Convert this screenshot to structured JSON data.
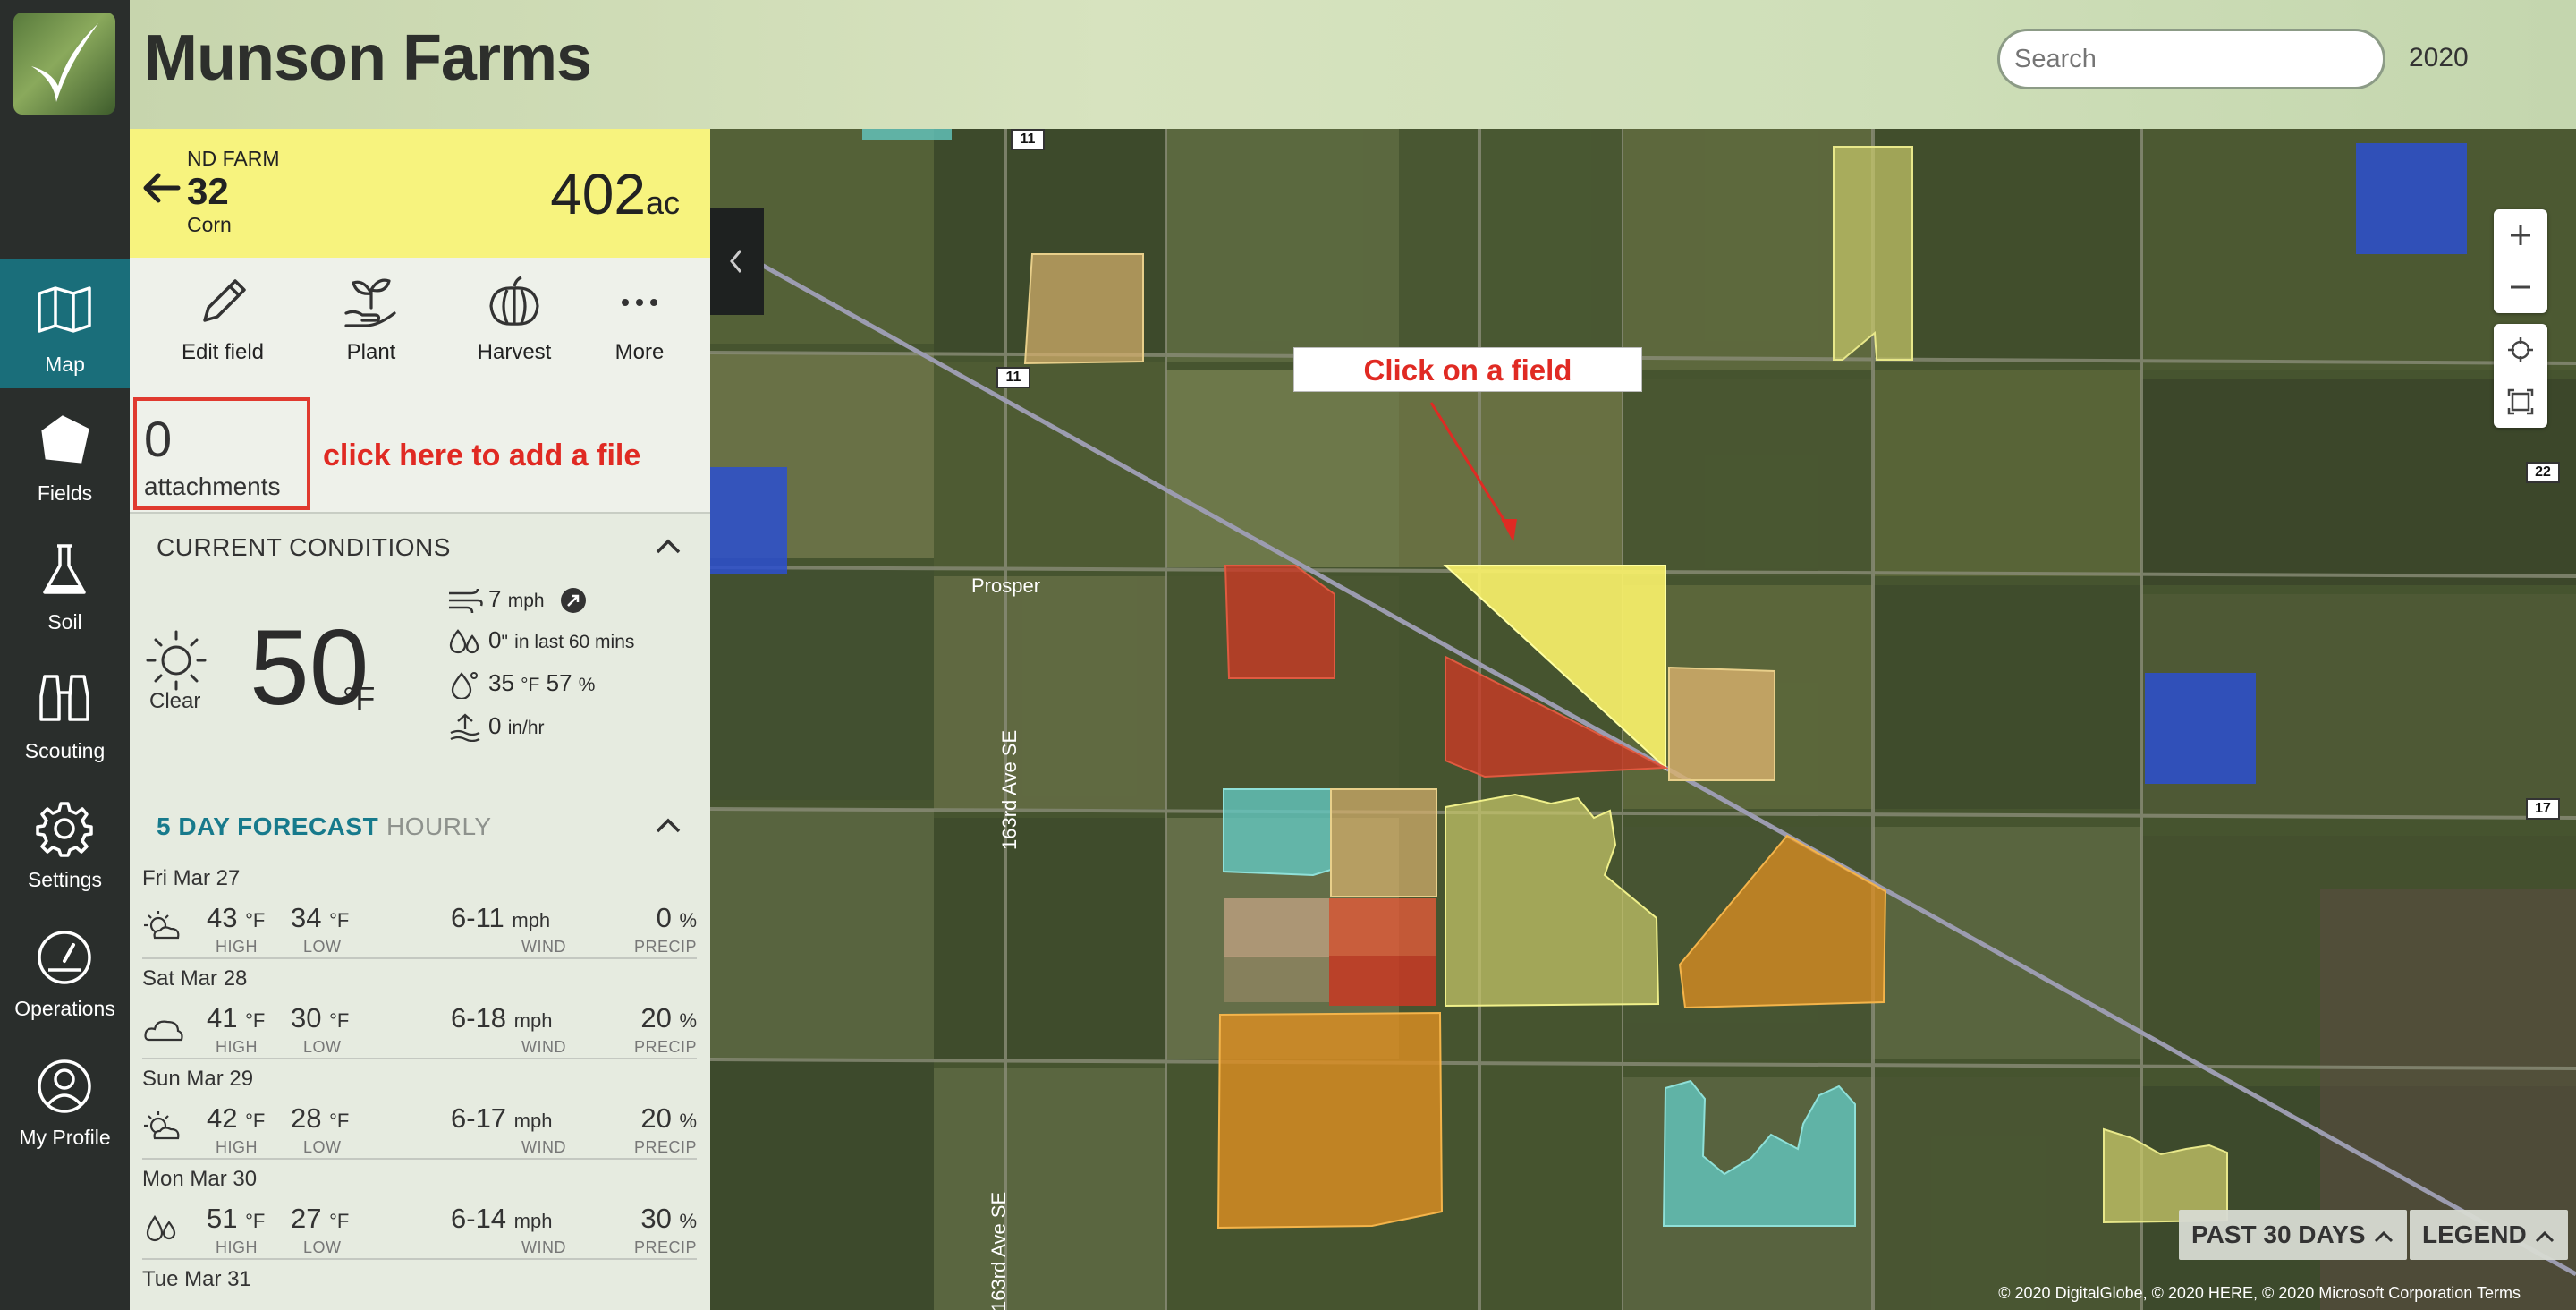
{
  "app": {
    "farm_name": "Munson Farms",
    "search_placeholder": "Search",
    "year": "2020"
  },
  "nav": {
    "items": [
      {
        "label": "Map",
        "icon": "map-icon",
        "active": true
      },
      {
        "label": "Fields",
        "icon": "fields-icon"
      },
      {
        "label": "Soil",
        "icon": "soil-flask-icon"
      },
      {
        "label": "Scouting",
        "icon": "binoculars-icon"
      },
      {
        "label": "Settings",
        "icon": "gear-icon"
      },
      {
        "label": "Operations",
        "icon": "gauge-icon"
      },
      {
        "label": "My Profile",
        "icon": "user-icon"
      }
    ]
  },
  "field": {
    "farm": "ND FARM",
    "number": "32",
    "crop": "Corn",
    "acres": "402",
    "acres_unit": "ac"
  },
  "actions": [
    {
      "label": "Edit field",
      "icon": "pencil-icon"
    },
    {
      "label": "Plant",
      "icon": "plant-icon"
    },
    {
      "label": "Harvest",
      "icon": "pumpkin-icon"
    },
    {
      "label": "More",
      "icon": "more-icon"
    }
  ],
  "attachments": {
    "count": "0",
    "label": "attachments",
    "hint": "click here to add a file"
  },
  "conditions": {
    "title": "CURRENT CONDITIONS",
    "summary": "Clear",
    "temp": "50",
    "temp_unit": "°F",
    "wind": "7",
    "wind_unit": "mph",
    "rain": "0",
    "rain_unit": "\"",
    "rain_note": "in last 60 mins",
    "dewpoint": "35",
    "dewpoint_unit": "°F",
    "humidity": "57",
    "humidity_unit": "%",
    "evap": "0",
    "evap_unit": "in/hr"
  },
  "forecast": {
    "tab_5day": "5 DAY FORECAST",
    "tab_hourly": "HOURLY",
    "hi_label": "HIGH",
    "lo_label": "LOW",
    "wind_label": "WIND",
    "precip_label": "PRECIP",
    "deg": "°F",
    "wind_unit": "mph",
    "pct": "%",
    "days": [
      {
        "day": "Fri Mar 27",
        "icon": "partly-sunny-icon",
        "hi": "43",
        "lo": "34",
        "wind": "6-11",
        "precip": "0"
      },
      {
        "day": "Sat Mar 28",
        "icon": "cloudy-icon",
        "hi": "41",
        "lo": "30",
        "wind": "6-18",
        "precip": "20"
      },
      {
        "day": "Sun Mar 29",
        "icon": "partly-sunny-icon",
        "hi": "42",
        "lo": "28",
        "wind": "6-17",
        "precip": "20"
      },
      {
        "day": "Mon Mar 30",
        "icon": "rain-drops-icon",
        "hi": "51",
        "lo": "27",
        "wind": "6-14",
        "precip": "30"
      },
      {
        "day": "Tue Mar 31",
        "icon": "partly-sunny-icon",
        "hi": "",
        "lo": "",
        "wind": "",
        "precip": ""
      }
    ]
  },
  "map": {
    "callout": "Click on a field",
    "place": "Prosper",
    "road_1": "163rd Ave SE",
    "road_2": "163rd Ave SE",
    "shield_11a": "11",
    "shield_11b": "11",
    "shield_22": "22",
    "shield_17": "17",
    "past_btn": "PAST 30 DAYS",
    "legend_btn": "LEGEND",
    "attribution": "© 2020 DigitalGlobe, © 2020 HERE, © 2020 Microsoft Corporation  Terms",
    "colors": {
      "yellow": "#f7f06a",
      "red": "#c93a25",
      "orange": "#df8f22",
      "blue": "#2c4fd0",
      "cyan": "#63c7c0",
      "tan": "#d9b26e",
      "olive": "#c9c96a"
    }
  }
}
